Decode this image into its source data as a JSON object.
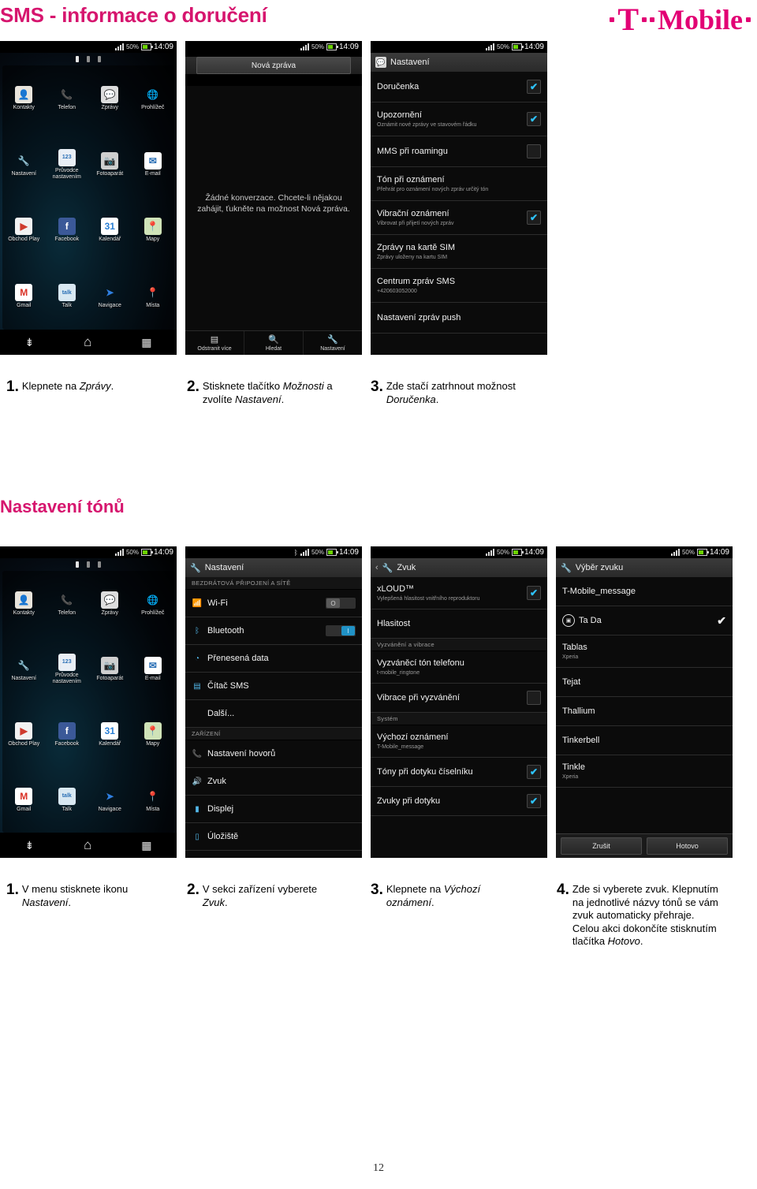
{
  "header": {
    "title": "SMS - informace o doručení",
    "logo_t": "T",
    "logo_word": "Mobile",
    "accent_color": "#e20074"
  },
  "section_title": "Nastavení tónů",
  "page_number": "12",
  "status_bar": {
    "percent": "50%",
    "clock": "14:09"
  },
  "home_screen": {
    "apps": [
      {
        "label": "Kontakty",
        "icon": "contacts-icon"
      },
      {
        "label": "Telefon",
        "icon": "phone-icon"
      },
      {
        "label": "Zprávy",
        "icon": "messages-icon"
      },
      {
        "label": "Prohlížeč",
        "icon": "browser-icon"
      },
      {
        "label": "Nastavení",
        "icon": "settings-icon"
      },
      {
        "label": "Průvodce nastavením",
        "icon": "setup-guide-icon"
      },
      {
        "label": "Fotoaparát",
        "icon": "camera-icon"
      },
      {
        "label": "E-mail",
        "icon": "email-icon"
      },
      {
        "label": "Obchod Play",
        "icon": "play-store-icon"
      },
      {
        "label": "Facebook",
        "icon": "facebook-icon"
      },
      {
        "label": "Kalendář",
        "icon": "calendar-icon"
      },
      {
        "label": "Mapy",
        "icon": "maps-icon"
      },
      {
        "label": "Gmail",
        "icon": "gmail-icon"
      },
      {
        "label": "Talk",
        "icon": "talk-icon"
      },
      {
        "label": "Navigace",
        "icon": "navigation-icon"
      },
      {
        "label": "Místa",
        "icon": "places-icon"
      }
    ]
  },
  "messages_screen": {
    "new_message_button": "Nová zpráva",
    "empty_text": "Žádné konverzace. Chcete-li nějakou zahájit, ťukněte na možnost Nová zpráva.",
    "bottom_bar": [
      {
        "label": "Odstranit více",
        "icon": "delete-multiple-icon"
      },
      {
        "label": "Hledat",
        "icon": "search-icon"
      },
      {
        "label": "Nastavení",
        "icon": "wrench-icon"
      }
    ]
  },
  "sms_settings_screen": {
    "title": "Nastavení",
    "rows": [
      {
        "main": "Doručenka",
        "sub": "",
        "checkbox": "checked"
      },
      {
        "main": "Upozornění",
        "sub": "Oznámit nové zprávy ve stavovém řádku",
        "checkbox": "checked"
      },
      {
        "main": "MMS při roamingu",
        "sub": "",
        "checkbox": "unchecked"
      },
      {
        "main": "Tón při oznámení",
        "sub": "Přehrát pro oznámení nových zpráv určitý tón",
        "checkbox": "none"
      },
      {
        "main": "Vibrační oznámení",
        "sub": "Vibrovat při přijetí nových zpráv",
        "checkbox": "checked"
      },
      {
        "main": "Zprávy na kartě SIM",
        "sub": "Zprávy uloženy na kartu SIM",
        "checkbox": "none"
      },
      {
        "main": "Centrum zpráv SMS",
        "sub": "+420603052000",
        "checkbox": "none"
      },
      {
        "main": "Nastavení zpráv push",
        "sub": "",
        "checkbox": "none"
      }
    ]
  },
  "android_settings_screen": {
    "title": "Nastavení",
    "sections": [
      {
        "header": "BEZDRÁTOVÁ PŘIPOJENÍ A SÍTĚ",
        "rows": [
          {
            "label": "Wi-Fi",
            "icon": "wifi-icon",
            "toggle": "off"
          },
          {
            "label": "Bluetooth",
            "icon": "bluetooth-icon",
            "toggle": "on"
          },
          {
            "label": "Přenesená data",
            "icon": "data-usage-icon",
            "toggle": "none"
          },
          {
            "label": "Čítač SMS",
            "icon": "sms-counter-icon",
            "toggle": "none"
          },
          {
            "label": "Další...",
            "icon": "none",
            "toggle": "none"
          }
        ]
      },
      {
        "header": "ZAŘÍZENÍ",
        "rows": [
          {
            "label": "Nastavení hovorů",
            "icon": "call-icon",
            "toggle": "none"
          },
          {
            "label": "Zvuk",
            "icon": "sound-icon",
            "toggle": "none"
          },
          {
            "label": "Displej",
            "icon": "display-icon",
            "toggle": "none"
          },
          {
            "label": "Úložiště",
            "icon": "storage-icon",
            "toggle": "none"
          }
        ]
      }
    ]
  },
  "sound_screen": {
    "title": "Zvuk",
    "rows": [
      {
        "main": "xLOUD™",
        "sub": "Vylepšená hlasitost vnitřního reproduktoru",
        "checkbox": "checked",
        "type": "row"
      },
      {
        "main": "Hlasitost",
        "sub": "",
        "checkbox": "none",
        "type": "row"
      },
      {
        "main": "Vyzvánění a vibrace",
        "sub": "",
        "checkbox": "none",
        "type": "header"
      },
      {
        "main": "Vyzváněcí tón telefonu",
        "sub": "t-mobile_ringtone",
        "checkbox": "none",
        "type": "row"
      },
      {
        "main": "Vibrace při vyzvánění",
        "sub": "",
        "checkbox": "unchecked",
        "type": "row"
      },
      {
        "main": "Systém",
        "sub": "",
        "checkbox": "none",
        "type": "header"
      },
      {
        "main": "Výchozí oznámení",
        "sub": "T-Mobile_message",
        "checkbox": "none",
        "type": "row"
      },
      {
        "main": "Tóny při dotyku číselníku",
        "sub": "",
        "checkbox": "checked",
        "type": "row"
      },
      {
        "main": "Zvuky při dotyku",
        "sub": "",
        "checkbox": "checked",
        "type": "row"
      }
    ]
  },
  "sound_picker_screen": {
    "title": "Výběr zvuku",
    "rows": [
      {
        "name": "T-Mobile_message",
        "sub": "",
        "selected": false,
        "playing": false
      },
      {
        "name": "Ta Da",
        "sub": "",
        "selected": true,
        "playing": true
      },
      {
        "name": "Tablas",
        "sub": "Xperia",
        "selected": false,
        "playing": false
      },
      {
        "name": "Tejat",
        "sub": "",
        "selected": false,
        "playing": false
      },
      {
        "name": "Thallium",
        "sub": "",
        "selected": false,
        "playing": false
      },
      {
        "name": "Tinkerbell",
        "sub": "",
        "selected": false,
        "playing": false
      },
      {
        "name": "Tinkle",
        "sub": "Xperia",
        "selected": false,
        "playing": false
      }
    ],
    "cancel_button": "Zrušit",
    "ok_button": "Hotovo"
  },
  "steps_row1": [
    {
      "num": "1.",
      "text": "Klepnete na Zprávy."
    },
    {
      "num": "2.",
      "text": "Stisknete tlačítko Možnosti a zvolíte Nastavení."
    },
    {
      "num": "3.",
      "text": "Zde stačí zatrhnout možnost Doručenka."
    }
  ],
  "steps_row2": [
    {
      "num": "1.",
      "text": "V menu stisknete ikonu Nastavení."
    },
    {
      "num": "2.",
      "text": "V sekci zařízení vyberete Zvuk."
    },
    {
      "num": "3.",
      "text": "Klepnete na Výchozí oznámení."
    },
    {
      "num": "4.",
      "text": "Zde si vyberete zvuk. Klepnutím na jednotlivé názvy tónů se vám zvuk automaticky přehraje. Celou akci dokončíte stisknutím tlačítka Hotovo."
    }
  ]
}
